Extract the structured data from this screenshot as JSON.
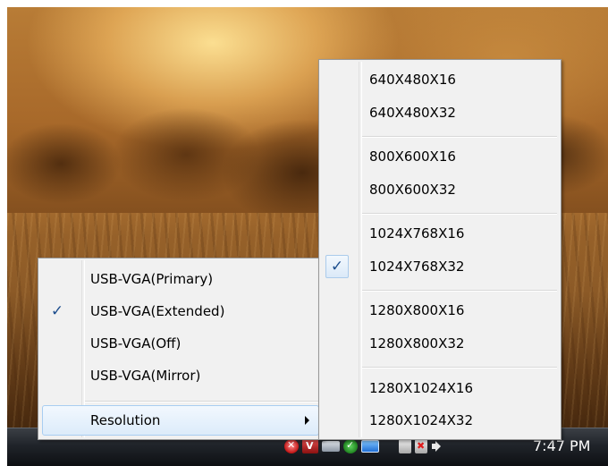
{
  "display_menu": {
    "items": [
      {
        "label": "USB-VGA(Primary)",
        "checked": false
      },
      {
        "label": "USB-VGA(Extended)",
        "checked": true
      },
      {
        "label": "USB-VGA(Off)",
        "checked": false
      },
      {
        "label": "USB-VGA(Mirror)",
        "checked": false
      }
    ],
    "resolution_label": "Resolution",
    "resolution_highlighted": true
  },
  "resolution_menu": {
    "items": [
      {
        "label": "640X480X16",
        "checked": false
      },
      {
        "label": "640X480X32",
        "checked": false
      },
      {
        "label": "800X600X16",
        "checked": false
      },
      {
        "label": "800X600X32",
        "checked": false
      },
      {
        "label": "1024X768X16",
        "checked": false
      },
      {
        "label": "1024X768X32",
        "checked": true
      },
      {
        "label": "1280X800X16",
        "checked": false
      },
      {
        "label": "1280X800X32",
        "checked": false
      },
      {
        "label": "1280X1024X16",
        "checked": false
      },
      {
        "label": "1280X1024X32",
        "checked": false
      }
    ]
  },
  "checkmark_glyph": "✓",
  "taskbar": {
    "clock": "7:47 PM",
    "tray_icons": [
      "antivirus-shield-icon",
      "vmware-icon",
      "drive-icon",
      "security-check-icon",
      "display-monitor-icon",
      "network-icon",
      "network-disconnected-icon",
      "volume-icon"
    ]
  },
  "colors": {
    "menu_background": "#f1f1f1",
    "highlight_border": "#a8cdf1",
    "check_color": "#1e4f8e"
  }
}
